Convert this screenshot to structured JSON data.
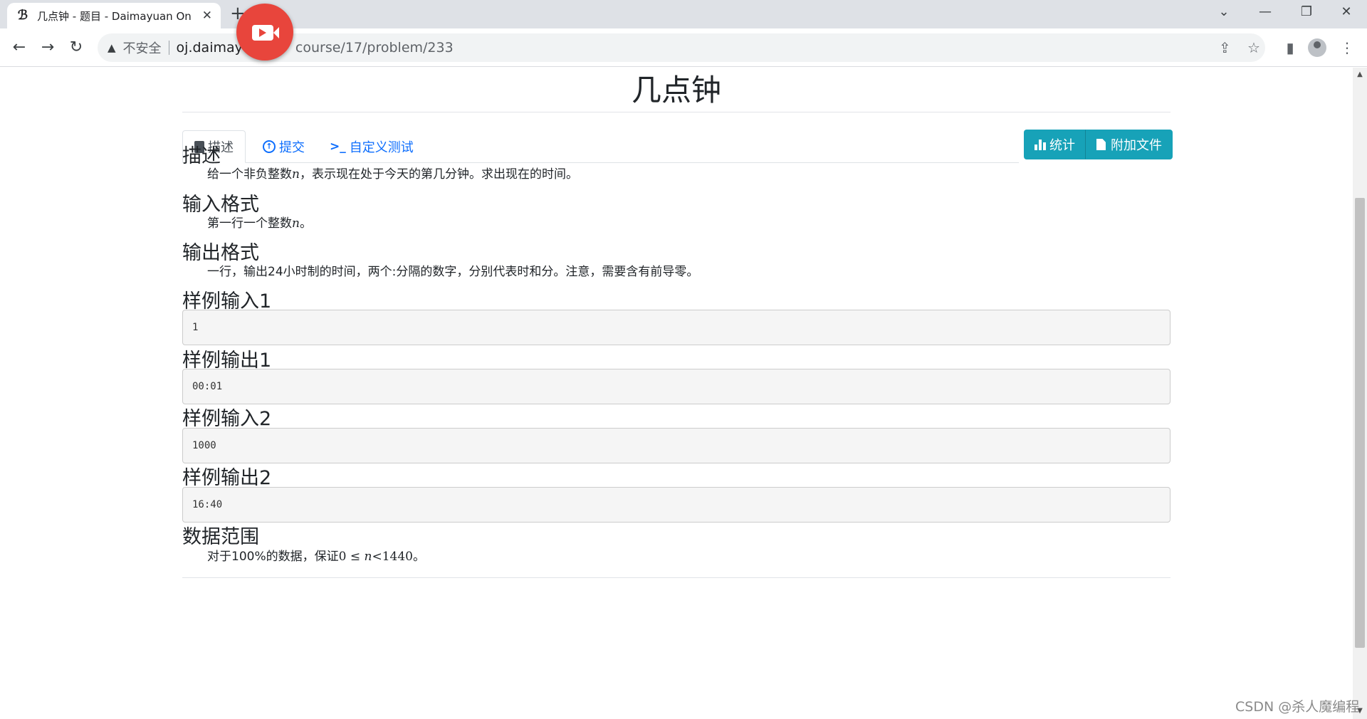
{
  "browser": {
    "tab_title": "几点钟 - 题目 - Daimayuan On",
    "favicon": "ℬ",
    "address": {
      "security_label": "不安全",
      "host": "oj.daimayu",
      "path": "course/17/problem/233"
    }
  },
  "problem": {
    "title": "几点钟",
    "tabs": [
      {
        "label": "描述",
        "icon": "book-icon"
      },
      {
        "label": "提交",
        "icon": "upload-icon"
      },
      {
        "label": "自定义测试",
        "icon": "terminal-icon"
      }
    ],
    "buttons": {
      "stats": "统计",
      "attachments": "附加文件"
    },
    "sections": {
      "description": {
        "heading": "描述",
        "before": "给一个非负整数",
        "var": "n",
        "after": "，表示现在处于今天的第几分钟。求出现在的时间。"
      },
      "input_format": {
        "heading": "输入格式",
        "before": "第一行一个整数",
        "var": "n",
        "after": "。"
      },
      "output_format": {
        "heading": "输出格式",
        "text": "一行，输出24小时制的时间，两个:分隔的数字，分别代表时和分。注意，需要含有前导零。"
      },
      "sample_input_1": {
        "heading": "样例输入1",
        "value": "1"
      },
      "sample_output_1": {
        "heading": "样例输出1",
        "value": "00:01"
      },
      "sample_input_2": {
        "heading": "样例输入2",
        "value": "1000"
      },
      "sample_output_2": {
        "heading": "样例输出2",
        "value": "16:40"
      },
      "data_range": {
        "heading": "数据范围",
        "before": "对于100%的数据，保证",
        "low": "0",
        "op1": " ≤ ",
        "var": "n",
        "op2": "<",
        "high": "1440",
        "after": "。"
      }
    }
  },
  "watermark": "CSDN @杀人魔编程"
}
